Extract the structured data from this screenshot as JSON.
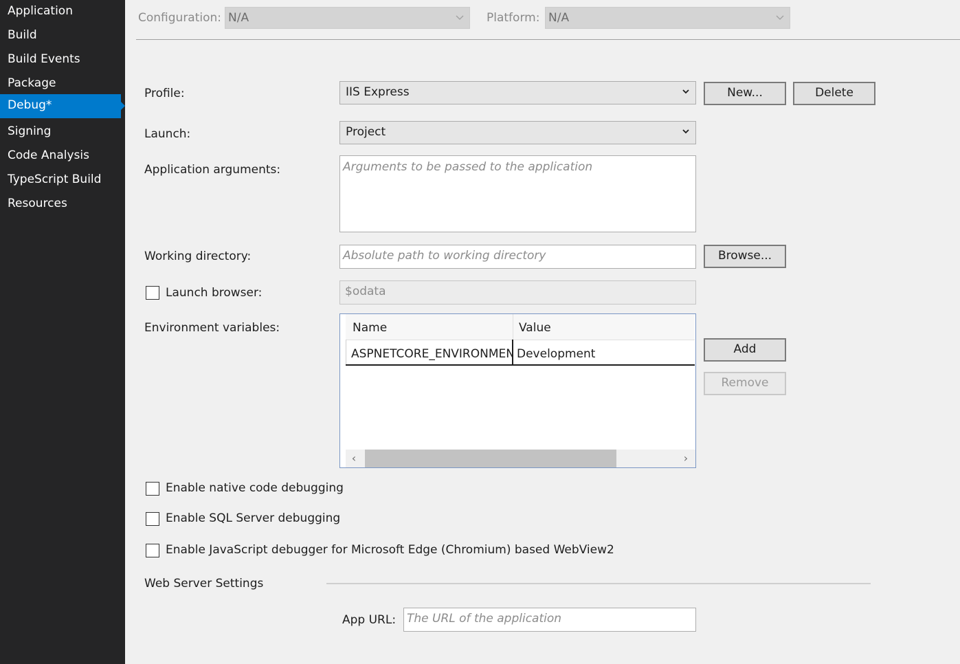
{
  "sidebar": {
    "items": [
      {
        "label": "Application"
      },
      {
        "label": "Build"
      },
      {
        "label": "Build Events"
      },
      {
        "label": "Package"
      },
      {
        "label": "Debug*",
        "active": true
      },
      {
        "label": "Signing"
      },
      {
        "label": "Code Analysis"
      },
      {
        "label": "TypeScript Build"
      },
      {
        "label": "Resources"
      }
    ]
  },
  "topbar": {
    "configuration_label": "Configuration:",
    "configuration_value": "N/A",
    "platform_label": "Platform:",
    "platform_value": "N/A"
  },
  "form": {
    "profile_label": "Profile:",
    "profile_value": "IIS Express",
    "new_button": "New...",
    "delete_button": "Delete",
    "launch_label": "Launch:",
    "launch_value": "Project",
    "app_args_label": "Application arguments:",
    "app_args_placeholder": "Arguments to be passed to the application",
    "working_dir_label": "Working directory:",
    "working_dir_placeholder": "Absolute path to working directory",
    "browse_button": "Browse...",
    "launch_browser_label": "Launch browser:",
    "launch_browser_checked": false,
    "launch_browser_value": "$odata",
    "env_vars_label": "Environment variables:",
    "env_columns": [
      "Name",
      "Value"
    ],
    "env_rows": [
      {
        "name": "ASPNETCORE_ENVIRONMENT",
        "value": "Development"
      }
    ],
    "add_button": "Add",
    "remove_button": "Remove",
    "native_debug_label": "Enable native code debugging",
    "sql_debug_label": "Enable SQL Server debugging",
    "js_debug_label": "Enable JavaScript debugger for Microsoft Edge (Chromium) based WebView2",
    "web_server_section": "Web Server Settings",
    "app_url_label": "App URL:",
    "app_url_placeholder": "The URL of the application"
  },
  "colors": {
    "sidebar_bg": "#252526",
    "accent": "#007acc",
    "page_bg": "#f0f0f0"
  }
}
